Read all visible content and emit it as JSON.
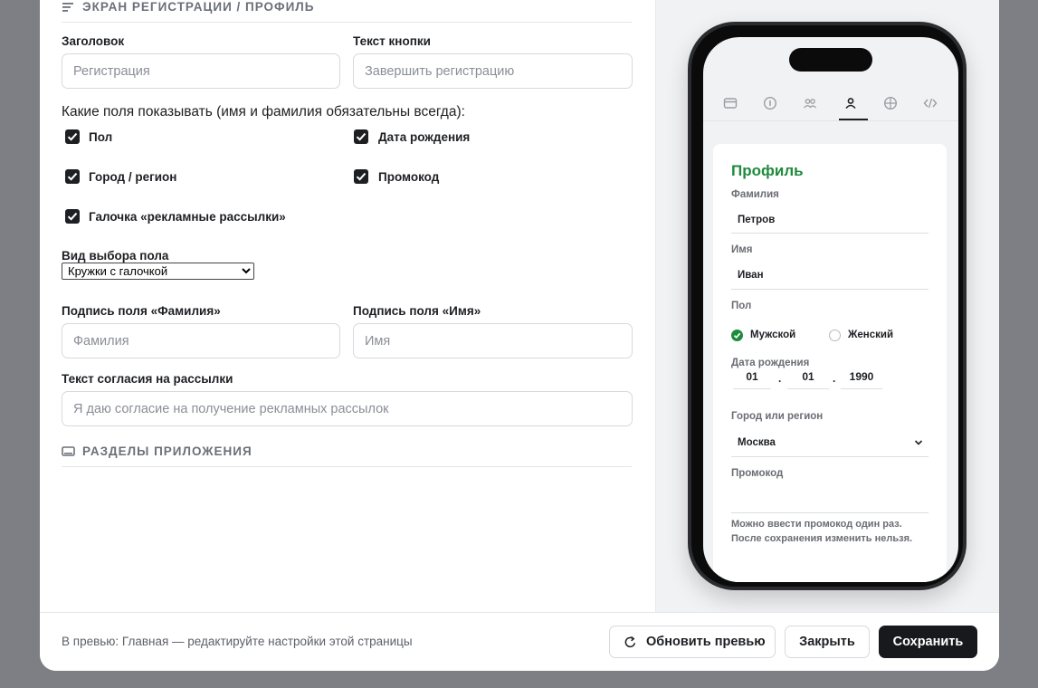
{
  "sections": {
    "profile_title": "ЭКРАН РЕГИСТРАЦИИ / ПРОФИЛЬ",
    "app_sections_title": "РАЗДЕЛЫ ПРИЛОЖЕНИЯ"
  },
  "form": {
    "title_label": "Заголовок",
    "title_placeholder": "Регистрация",
    "button_text_label": "Текст кнопки",
    "button_text_placeholder": "Завершить регистрацию",
    "fields_question": "Какие поля показывать (имя и фамилия обязательны всегда):",
    "checkboxes": [
      {
        "label": "Пол",
        "checked": true
      },
      {
        "label": "Дата рождения",
        "checked": true
      },
      {
        "label": "Город / регион",
        "checked": true
      },
      {
        "label": "Промокод",
        "checked": true
      },
      {
        "label": "Галочка «рекламные рассылки»",
        "checked": true
      }
    ],
    "gender_select_label": "Вид выбора пола",
    "gender_select_value": "Кружки с галочкой",
    "lastname_caption_label": "Подпись поля «Фамилия»",
    "lastname_caption_placeholder": "Фамилия",
    "firstname_caption_label": "Подпись поля «Имя»",
    "firstname_caption_placeholder": "Имя",
    "consent_label": "Текст согласия на рассылки",
    "consent_placeholder": "Я даю согласие на получение рекламных рассылок"
  },
  "footer": {
    "status": "В превью: Главная — редактируйте настройки этой страницы",
    "refresh_label": "Обновить превью",
    "close_label": "Закрыть",
    "save_label": "Сохранить"
  },
  "preview": {
    "card_title": "Профиль",
    "lastname_label": "Фамилия",
    "lastname_value": "Петров",
    "firstname_label": "Имя",
    "firstname_value": "Иван",
    "gender_label": "Пол",
    "gender_male": "Мужской",
    "gender_female": "Женский",
    "birthdate_label": "Дата рождения",
    "birth_day": "01",
    "birth_month": "01",
    "birth_year": "1990",
    "city_label": "Город или регион",
    "city_value": "Москва",
    "promo_label": "Промокод",
    "promo_hint": "Можно ввести промокод один раз. После сохранения изменить нельзя.",
    "accent_color": "#1f8a3c"
  }
}
